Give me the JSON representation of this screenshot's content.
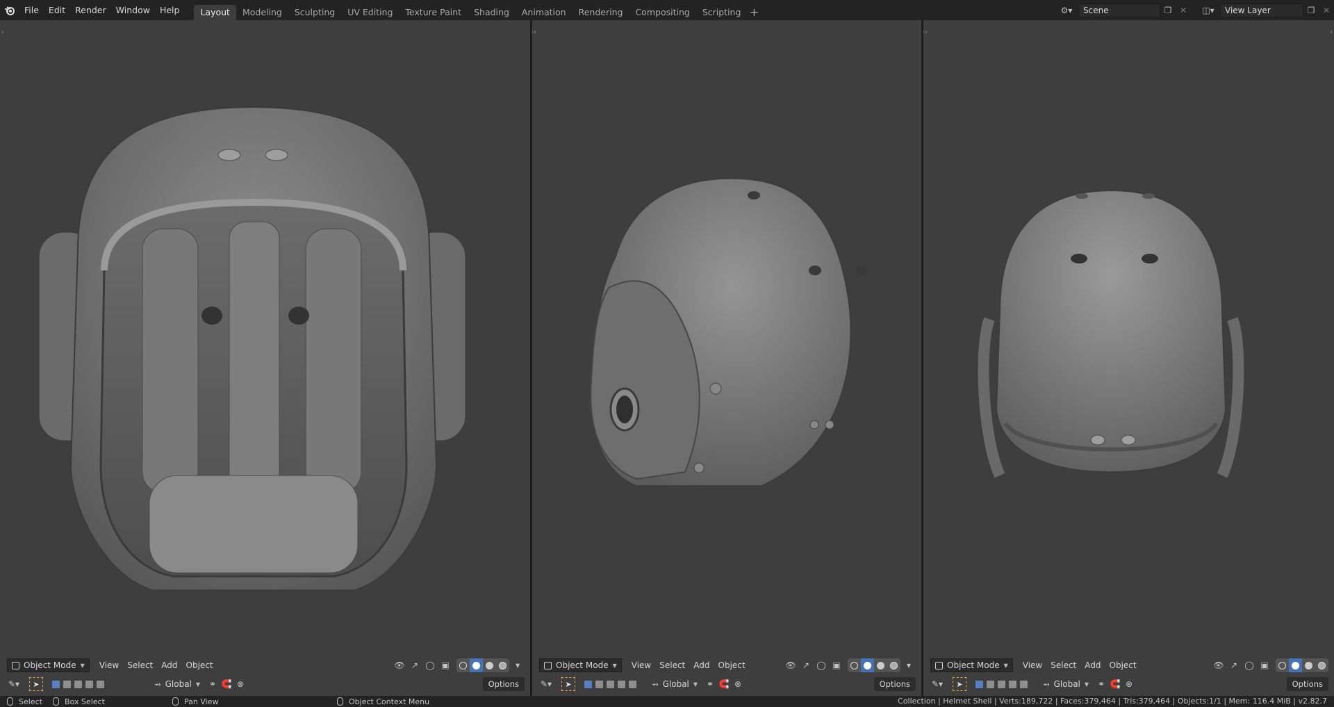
{
  "menu": [
    "File",
    "Edit",
    "Render",
    "Window",
    "Help"
  ],
  "workspaces": [
    {
      "label": "Layout",
      "active": true
    },
    {
      "label": "Modeling",
      "active": false
    },
    {
      "label": "Sculpting",
      "active": false
    },
    {
      "label": "UV Editing",
      "active": false
    },
    {
      "label": "Texture Paint",
      "active": false
    },
    {
      "label": "Shading",
      "active": false
    },
    {
      "label": "Animation",
      "active": false
    },
    {
      "label": "Rendering",
      "active": false
    },
    {
      "label": "Compositing",
      "active": false
    },
    {
      "label": "Scripting",
      "active": false
    }
  ],
  "add_workspace": "+",
  "scene": {
    "value": "Scene"
  },
  "view_layer": {
    "value": "View Layer"
  },
  "viewport_header": {
    "mode": "Object Mode",
    "view": "View",
    "select": "Select",
    "add": "Add",
    "object": "Object",
    "options": "Options",
    "transform_orientation": "Global"
  },
  "status": {
    "select": "Select",
    "box_select": "Box Select",
    "pan_view": "Pan View",
    "context_menu": "Object Context Menu",
    "stats": "Collection | Helmet Shell | Verts:189,722 | Faces:379,464 | Tris:379,464 | Objects:1/1 | Mem: 116.4 MiB | v2.82.7"
  },
  "colors": {
    "accent": "#4772b3",
    "viewport_bg": "#3e3e3e",
    "header_bg": "#232323",
    "select_outline": "#e8a848"
  }
}
